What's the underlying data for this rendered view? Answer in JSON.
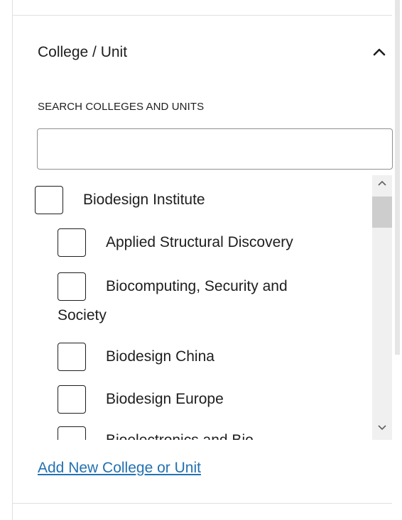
{
  "section": {
    "title": "College / Unit",
    "collapse_icon": "chevron-up-icon"
  },
  "search": {
    "label": "SEARCH COLLEGES AND UNITS",
    "value": "",
    "placeholder": ""
  },
  "checklist": {
    "items": [
      {
        "label": "Biodesign Institute",
        "level": 0,
        "checked": false
      },
      {
        "label": "Applied Structural Discovery",
        "level": 1,
        "checked": false
      },
      {
        "label": "Biocomputing, Security and",
        "label_wrap": "Society",
        "level": 1,
        "checked": false
      },
      {
        "label": "Biodesign China",
        "level": 1,
        "checked": false
      },
      {
        "label": "Biodesign Europe",
        "level": 1,
        "checked": false
      },
      {
        "label": "Bioelectronics and Bio...",
        "level": 1,
        "checked": false
      }
    ]
  },
  "add_link": {
    "label": "Add New College or Unit"
  },
  "colors": {
    "link": "#2271b1",
    "text": "#1e1e1e",
    "border": "#8c8f94"
  }
}
